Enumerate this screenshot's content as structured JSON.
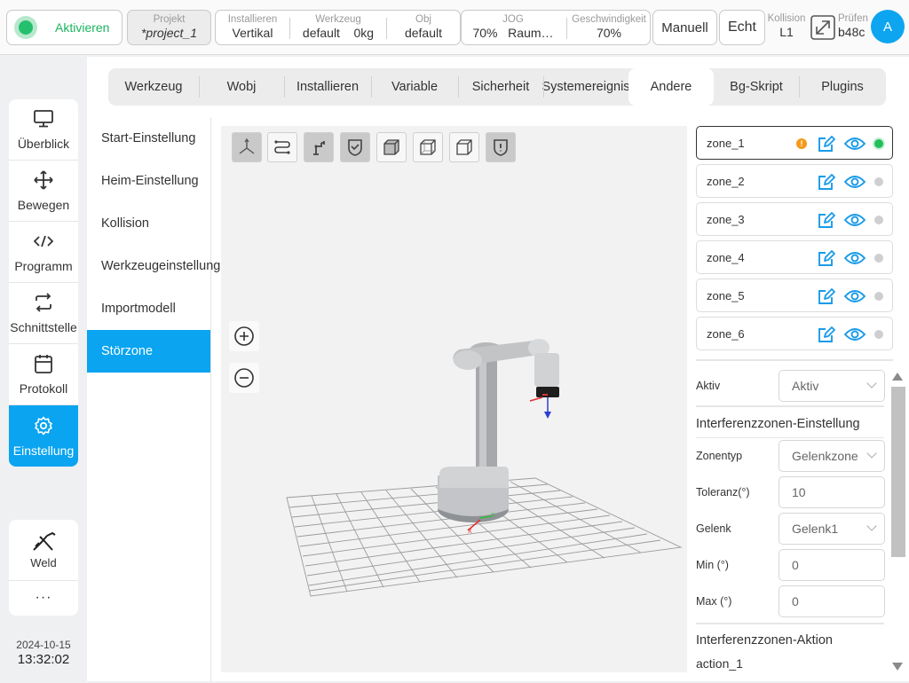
{
  "topbar": {
    "activate_label": "Aktivieren",
    "project": {
      "key": "Projekt",
      "value": "*project_1"
    },
    "install": {
      "key": "Installieren",
      "value": "Vertikal"
    },
    "tool": {
      "key": "Werkzeug",
      "value": "default",
      "extra": "0kg"
    },
    "obj": {
      "key": "Obj",
      "value": "default"
    },
    "jog": {
      "key": "JOG",
      "value": "70%",
      "extra": "Raum…"
    },
    "speed": {
      "key": "Geschwindigkeit",
      "value": "70%"
    },
    "manual_label": "Manuell",
    "real_label": "Echt",
    "collision": {
      "key": "Kollision",
      "value": "L1"
    },
    "check": {
      "key": "Prüfen",
      "value": "b48c"
    },
    "avatar_letter": "A",
    "accent_color": "#0aa4f0",
    "active_color": "#25c06d"
  },
  "nav": {
    "items": [
      {
        "label": "Überblick",
        "icon": "monitor-icon"
      },
      {
        "label": "Bewegen",
        "icon": "move-arrows-icon"
      },
      {
        "label": "Programm",
        "icon": "code-icon"
      },
      {
        "label": "Schnittstelle",
        "icon": "swap-icon"
      },
      {
        "label": "Protokoll",
        "icon": "calendar-icon"
      },
      {
        "label": "Einstellung",
        "icon": "gear-icon",
        "active": true
      }
    ],
    "weld_label": "Weld",
    "more_label": "···"
  },
  "datetime": {
    "date": "2024-10-15",
    "time": "13:32:02"
  },
  "tabs": [
    "Werkzeug",
    "Wobj",
    "Installieren",
    "Variable",
    "Sicherheit",
    "Systemereignis",
    "Andere",
    "Bg-Skript",
    "Plugins"
  ],
  "active_tab": "Andere",
  "subnav": [
    "Start-Einstellung",
    "Heim-Einstellung",
    "Kollision",
    "Werkzeugeinstellung",
    "Importmodell",
    "Störzone"
  ],
  "active_subnav": "Störzone",
  "viewport": {
    "toolbar_icons": [
      "axis-view-icon",
      "path-icon",
      "robot-arm-icon",
      "shield-icon",
      "cube-solid-icon",
      "cube-wire-icon",
      "cube-outline-icon",
      "shield-alert-icon"
    ],
    "zoom_in": "zoom-in-icon",
    "zoom_out": "zoom-out-icon"
  },
  "zones": [
    {
      "name": "zone_1",
      "warning": true,
      "active": true
    },
    {
      "name": "zone_2",
      "warning": false,
      "active": false
    },
    {
      "name": "zone_3",
      "warning": false,
      "active": false
    },
    {
      "name": "zone_4",
      "warning": false,
      "active": false
    },
    {
      "name": "zone_5",
      "warning": false,
      "active": false
    },
    {
      "name": "zone_6",
      "warning": false,
      "active": false
    }
  ],
  "props": {
    "active": {
      "label": "Aktiv",
      "value": "Aktiv"
    },
    "setting_title": "Interferenzzonen-Einstellung",
    "zone_type": {
      "label": "Zonentyp",
      "value": "Gelenkzone"
    },
    "tolerance": {
      "label": "Toleranz(°)",
      "value": "10"
    },
    "joint": {
      "label": "Gelenk",
      "value": "Gelenk1"
    },
    "min": {
      "label": "Min (°)",
      "value": "0"
    },
    "max": {
      "label": "Max (°)",
      "value": "0"
    },
    "action_title": "Interferenzzonen-Aktion",
    "action_value": "action_1"
  }
}
